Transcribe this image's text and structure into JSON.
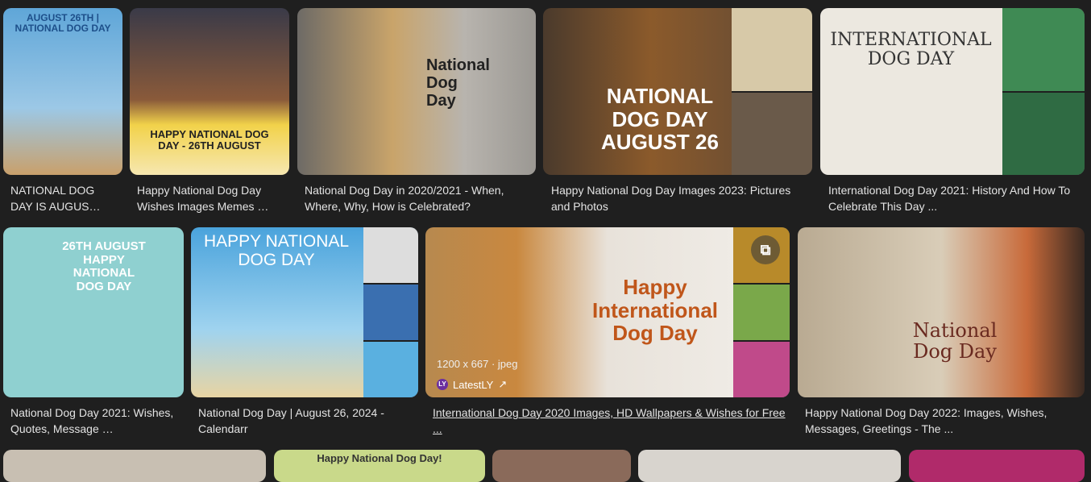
{
  "results": [
    {
      "title": "NATIONAL DOG DAY IS AUGUS…",
      "img_text": "AUGUST 26TH | NATIONAL DOG DAY"
    },
    {
      "title": "Happy National Dog Day Wishes Images Memes …",
      "img_text": "HAPPY NATIONAL DOG DAY - 26TH AUGUST"
    },
    {
      "title": "National Dog Day in 2020/2021 - When, Where, Why, How is Celebrated?",
      "img_text": "National Dog Day"
    },
    {
      "title": "Happy National Dog Day Images 2023: Pictures and Photos",
      "img_text": "NATIONAL DOG DAY AUGUST 26"
    },
    {
      "title": "International Dog Day 2021: History And How To Celebrate This Day ...",
      "img_text": "INTERNATIONAL DOG DAY"
    },
    {
      "title": "National Dog Day 2021: Wishes, Quotes, Message …",
      "img_text": "26TH AUGUST HAPPY NATIONAL DOG DAY"
    },
    {
      "title": "National Dog Day | August 26, 2024 - Calendarr",
      "img_text": "HAPPY NATIONAL DOG DAY"
    },
    {
      "title": "International Dog Day 2020 Images, HD Wallpapers & Wishes for Free ...",
      "img_text": "Happy International Dog Day",
      "meta": "1200 x 667 · jpeg",
      "source": "LatestLY",
      "source_badge": "LY"
    },
    {
      "title": "Happy National Dog Day 2022: Images, Wishes, Messages, Greetings - The ...",
      "img_text": "National Dog Day"
    }
  ],
  "row3_partial": [
    {
      "img_text": "Happy National Dog Day!"
    }
  ]
}
